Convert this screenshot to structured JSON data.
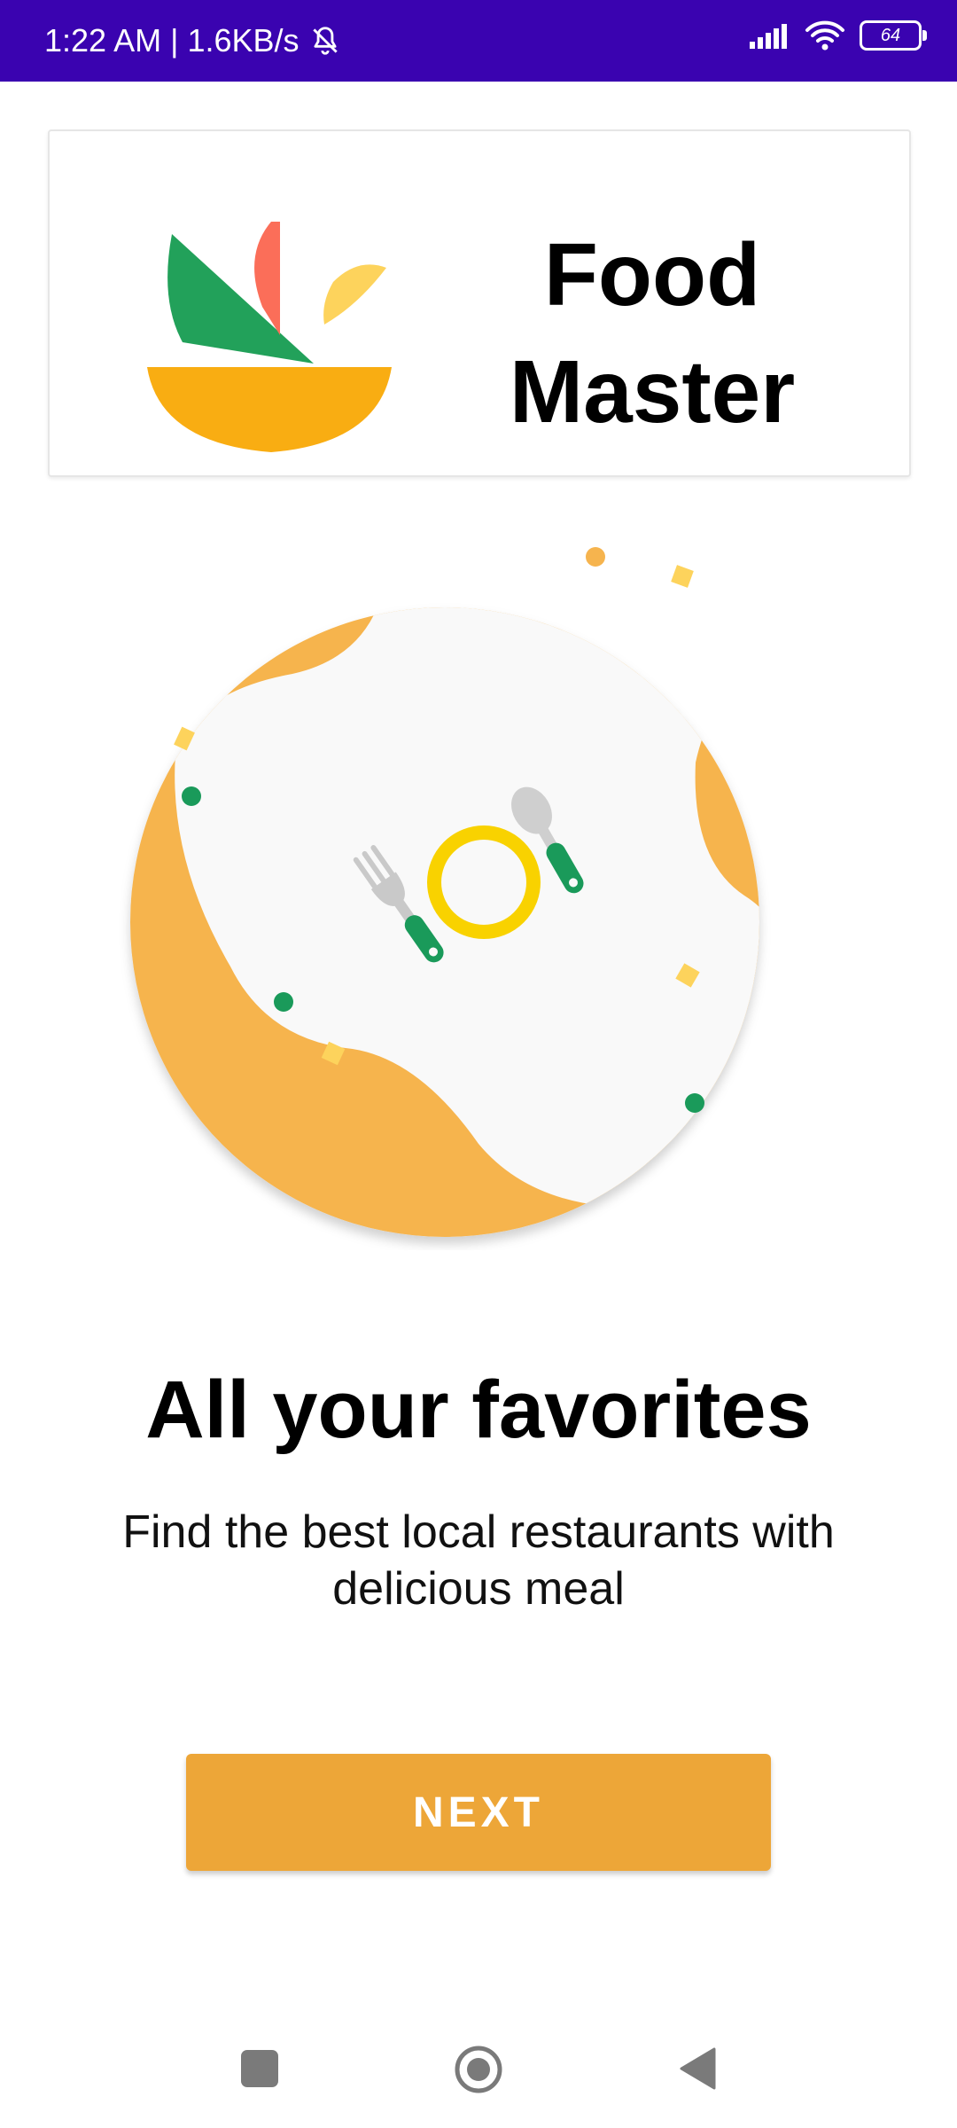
{
  "status_bar": {
    "time": "1:22 AM",
    "separator": "|",
    "network_speed": "1.6KB/s",
    "battery_level": "64",
    "icons": [
      "bell-off-icon",
      "signal-icon",
      "wifi-icon",
      "battery-icon"
    ],
    "background_color": "#3a03b0"
  },
  "header": {
    "app_title": "Food\nMaster",
    "logo_icon": "food-bowl-logo-icon"
  },
  "illustration": {
    "icon": "plate-fork-spoon-illustration",
    "colors": {
      "orange": "#f6b44e",
      "yellow": "#f9d200",
      "green": "#1a9a5a",
      "plate_bg": "#f9f9f9"
    }
  },
  "onboarding": {
    "headline": "All your favorites",
    "description": "Find the best local restaurants with delicious meal"
  },
  "actions": {
    "next_label": "NEXT",
    "accent_color": "#eda638"
  },
  "nav_bar": {
    "icons": [
      "recent-apps-icon",
      "home-icon",
      "back-icon"
    ]
  }
}
